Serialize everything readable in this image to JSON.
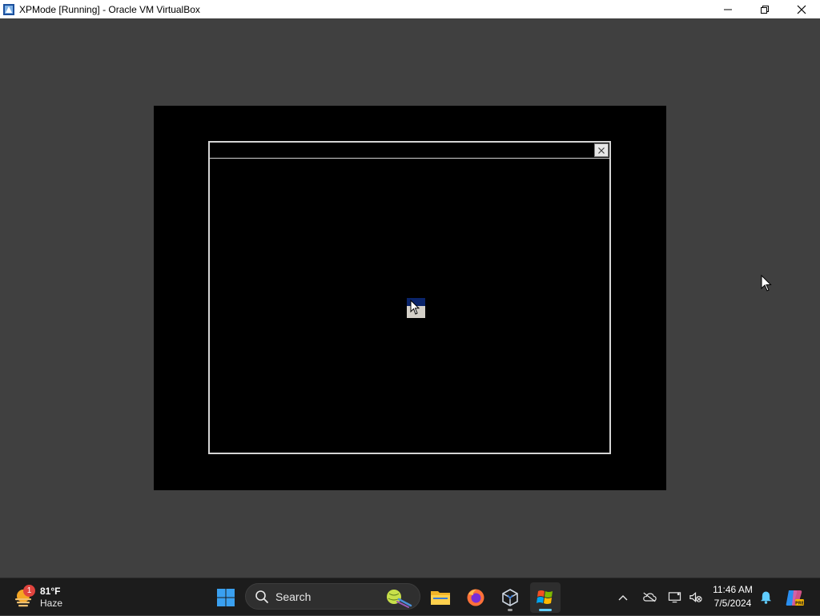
{
  "window": {
    "title": "XPMode [Running] - Oracle VM VirtualBox",
    "icons": {
      "app": "virtualbox-icon",
      "minimize": "minimize-icon",
      "restore": "restore-icon",
      "close": "close-icon"
    }
  },
  "guest": {
    "dialog_close_icon": "close-icon",
    "cursor_icon": "arrow-cursor-icon"
  },
  "taskbar": {
    "weather": {
      "temperature": "81°F",
      "condition": "Haze",
      "badge": "1",
      "icon": "haze-sun-icon"
    },
    "start_icon": "windows-logo-icon",
    "search": {
      "placeholder": "Search",
      "icon": "search-icon"
    },
    "apps": [
      {
        "name": "File Explorer",
        "icon": "folder-icon"
      },
      {
        "name": "Firefox",
        "icon": "firefox-icon"
      },
      {
        "name": "VirtualBox",
        "icon": "virtualbox-icon"
      },
      {
        "name": "XPMode",
        "icon": "windows-xp-logo-icon"
      }
    ],
    "tray": {
      "icons": [
        "chevron-up-icon",
        "cloud-offline-icon",
        "display-icon",
        "volume-muted-icon"
      ],
      "time": "11:46 AM",
      "date": "7/5/2024",
      "notification_icon": "bell-icon",
      "copilot_icon": "copilot-icon"
    }
  },
  "colors": {
    "host_background": "#404040",
    "vm_screen": "#000000",
    "taskbar": "#1c1c1c",
    "accent": "#60cdff"
  }
}
